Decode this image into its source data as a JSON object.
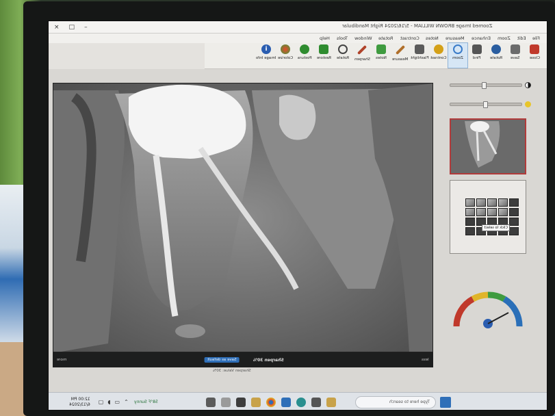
{
  "window": {
    "title": "Zoomed Image BROWN WILLIAM - 5/16/2024  Right Mandibular",
    "controls": [
      "×",
      "□",
      "–"
    ]
  },
  "menu": [
    "File",
    "Edit",
    "Zoom",
    "Enhance",
    "Measure",
    "Notes",
    "Contrast",
    "Rotate",
    "Window",
    "Tools",
    "Help"
  ],
  "ribbon": [
    {
      "label": "Close",
      "icon": "close-folder-icon",
      "color": "#c0392b"
    },
    {
      "label": "Save",
      "icon": "save-icon",
      "color": "#6b6b6b"
    },
    {
      "label": "Rotate",
      "icon": "rotate-icon",
      "color": "#2a5d9f"
    },
    {
      "label": "Find",
      "icon": "find-icon",
      "color": "#555555"
    },
    {
      "label": "Zoom",
      "icon": "zoom-icon",
      "color": "#3a7bc8",
      "active": true
    },
    {
      "label": "Contrast",
      "icon": "contrast-icon",
      "color": "#d4a017"
    },
    {
      "label": "Flashlight",
      "icon": "flashlight-icon",
      "color": "#5b5b5b"
    },
    {
      "label": "Measure",
      "icon": "measure-icon",
      "color": "#b06f2a"
    },
    {
      "label": "Notes",
      "icon": "notes-icon",
      "color": "#3f9b3f"
    },
    {
      "label": "Sharpen",
      "icon": "sharpen-icon",
      "color": "#b0432a"
    },
    {
      "label": "Rotate",
      "icon": "rotate2-icon",
      "color": "#444444"
    },
    {
      "label": "Restore",
      "icon": "restore-icon",
      "color": "#2f8c2f"
    },
    {
      "label": "Postura",
      "icon": "posture-icon",
      "color": "#2f8c2f"
    },
    {
      "label": "Colorize",
      "icon": "colorize-icon",
      "color": "#c44a2a"
    },
    {
      "label": "Image Info",
      "icon": "info-icon",
      "color": "#2a5db0"
    }
  ],
  "viewer": {
    "status_left": "more",
    "save_default": "Save as default",
    "mode": "Sharpen 30%",
    "status_right": "less",
    "sub_status": "Sharpen Value: 30%"
  },
  "layout_tip": "Click to select",
  "taskbar": {
    "time": "12:00 PM",
    "date": "6/13/2024",
    "weather": "58°F Sunny",
    "search_placeholder": "Type here to search",
    "app_colors": [
      "#5b5b5b",
      "#9a9a9a",
      "#3d3d3d",
      "#c8a24a",
      "#2f6fb8",
      "#d9472b",
      "#2f6fb8",
      "#2a8f8f",
      "#555555",
      "#c8a24a"
    ]
  },
  "colors": {
    "accent": "#2f6fb8",
    "selection_border": "#b13a3a",
    "screen_bg": "#e4e2de"
  }
}
